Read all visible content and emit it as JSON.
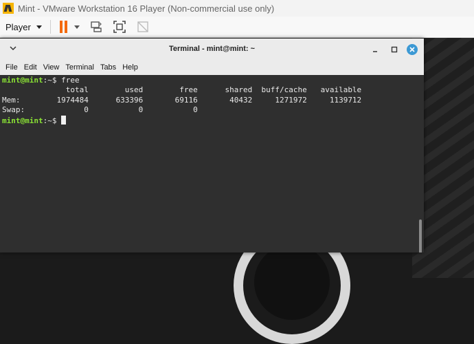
{
  "vmware": {
    "title": "Mint - VMware Workstation 16 Player (Non-commercial use only)",
    "player_menu": "Player"
  },
  "terminal": {
    "title": "Terminal - mint@mint: ~",
    "menu": [
      "File",
      "Edit",
      "View",
      "Terminal",
      "Tabs",
      "Help"
    ],
    "prompt": "mint@mint",
    "prompt_suffix": ":~$ ",
    "command": "free",
    "lines": [
      "              total        used        free      shared  buff/cache   available",
      "Mem:        1974484      633396       69116       40432     1271972     1139712",
      "Swap:             0           0           0"
    ]
  },
  "colors": {
    "prompt": "#8ae234",
    "pause": "#f46a0e",
    "close": "#3c99d4"
  }
}
